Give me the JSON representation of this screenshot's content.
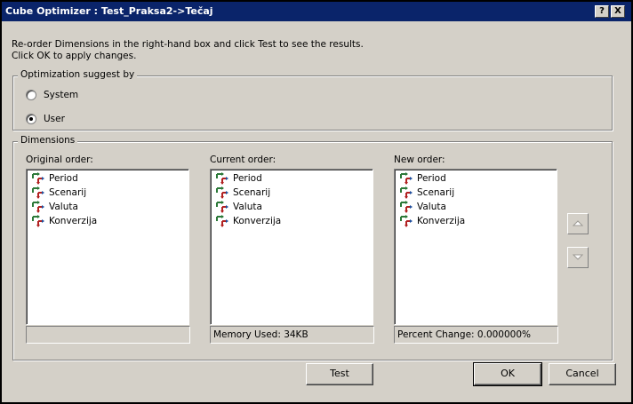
{
  "window": {
    "title": "Cube Optimizer : Test_Praksa2->Tečaj",
    "help_glyph": "?",
    "close_glyph": "X"
  },
  "instructions": {
    "line1": "Re-order Dimensions in the right-hand box and click Test to see the results.",
    "line2": "Click OK to apply changes."
  },
  "optimization": {
    "legend": "Optimization suggest by",
    "options": [
      {
        "label": "System",
        "checked": false
      },
      {
        "label": "User",
        "checked": true
      }
    ]
  },
  "dimensions": {
    "legend": "Dimensions",
    "original": {
      "label": "Original order:",
      "items": [
        "Period",
        "Scenarij",
        "Valuta",
        "Konverzija"
      ],
      "status": ""
    },
    "current": {
      "label": "Current order:",
      "items": [
        "Period",
        "Scenarij",
        "Valuta",
        "Konverzija"
      ],
      "status": "Memory Used: 34KB"
    },
    "new": {
      "label": "New order:",
      "items": [
        "Period",
        "Scenarij",
        "Valuta",
        "Konverzija"
      ],
      "status": "Percent Change: 0.000000%"
    }
  },
  "buttons": {
    "test": "Test",
    "ok": "OK",
    "cancel": "Cancel"
  },
  "icons": {
    "dimension": "dimension-icon",
    "move_up": "arrow-up-icon",
    "move_down": "arrow-down-icon"
  }
}
